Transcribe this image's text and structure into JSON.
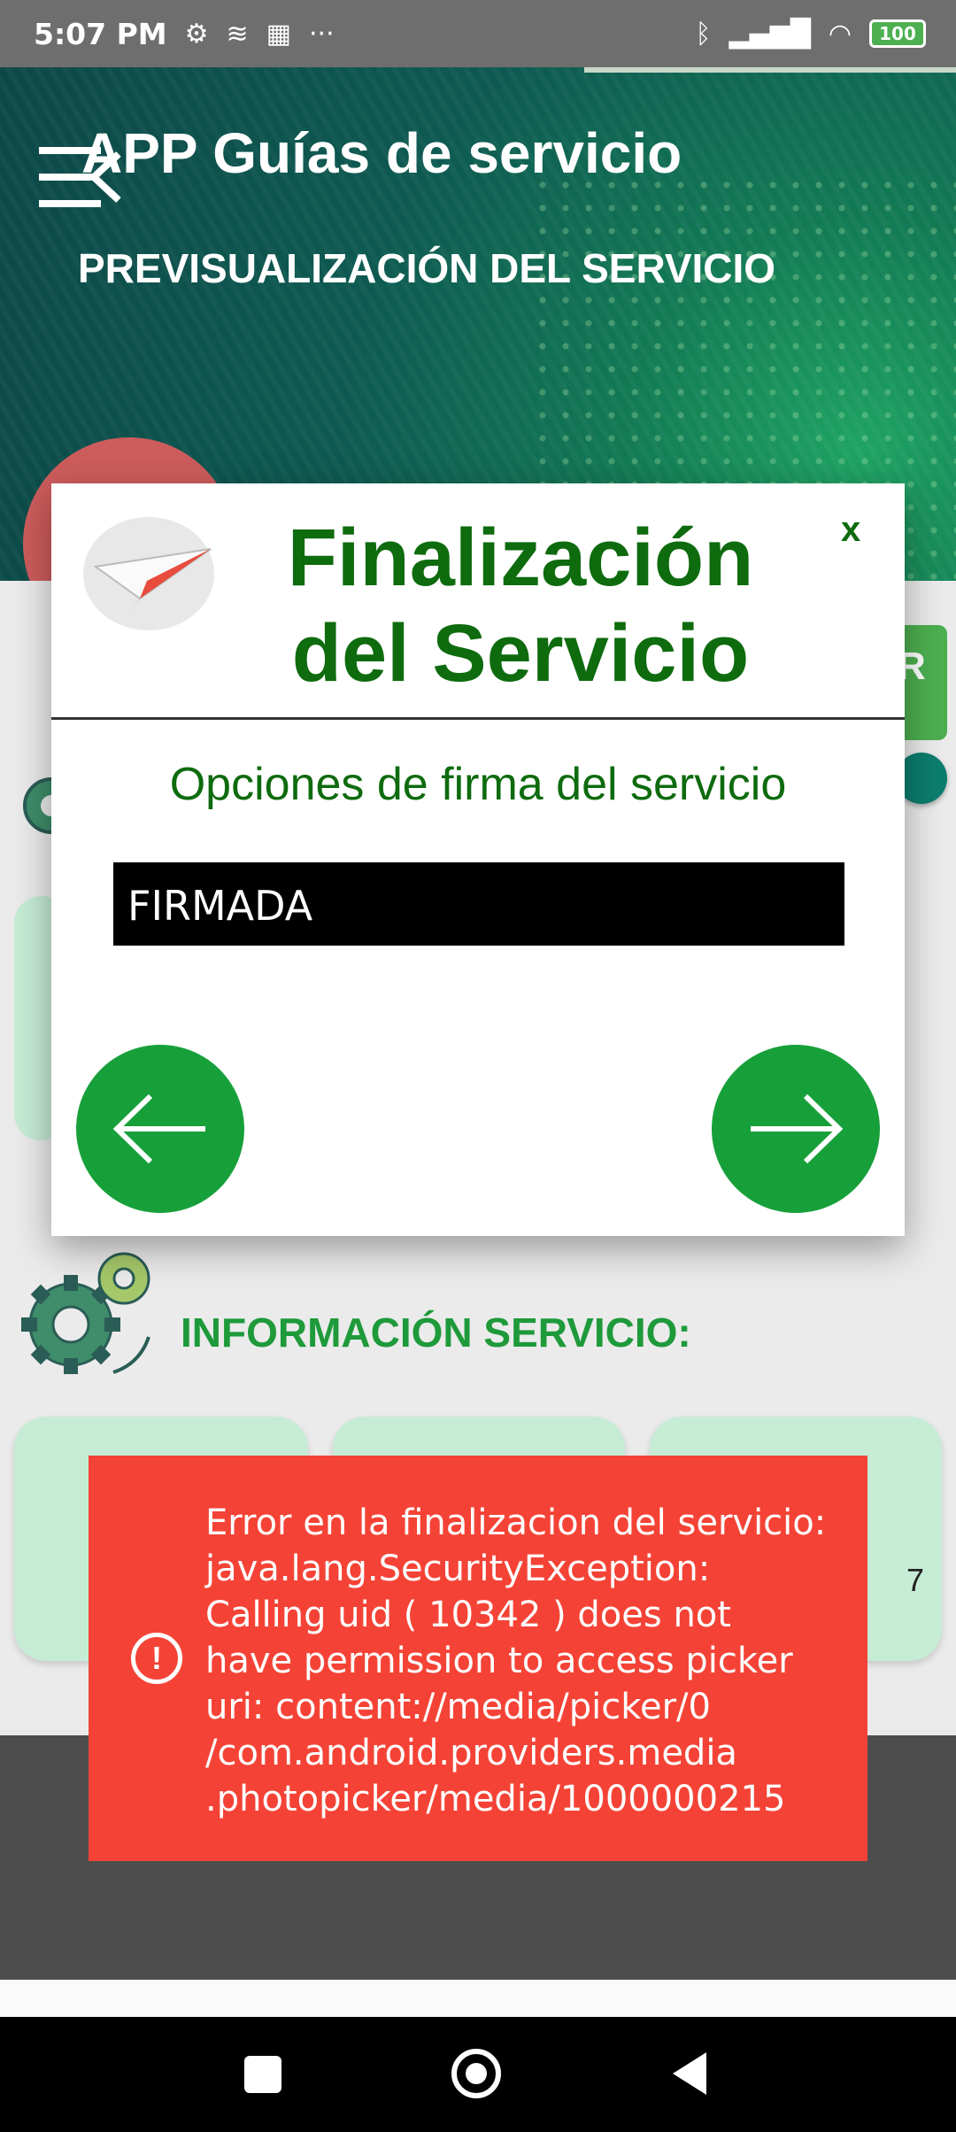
{
  "status_bar": {
    "time": "5:07 PM",
    "battery": "100"
  },
  "header": {
    "app_title": "APP Guías de servicio",
    "subtitle": "PREVISUALIZACIÓN DEL SERVICIO"
  },
  "background": {
    "right_button_letter": "R",
    "info_title": "INFORMACIÓN SERVICIO:",
    "card_value_3": "7"
  },
  "modal": {
    "title_line1": "Finalización",
    "title_line2": "del Servicio",
    "close_label": "x",
    "subtitle": "Opciones de firma del servicio",
    "select_value": "FIRMADA"
  },
  "toast": {
    "lines": [
      "Error en la finalizacion del servicio:",
      "java.lang.SecurityException:",
      "Calling uid ( 10342 ) does not",
      "have permission to access picker",
      "uri: content://media/picker/0",
      "/com.android.providers.media",
      ".photopicker/media/1000000215"
    ]
  },
  "colors": {
    "accent_green": "#17a03a",
    "title_green": "#0e6b0e",
    "toast_red": "#f44336"
  }
}
